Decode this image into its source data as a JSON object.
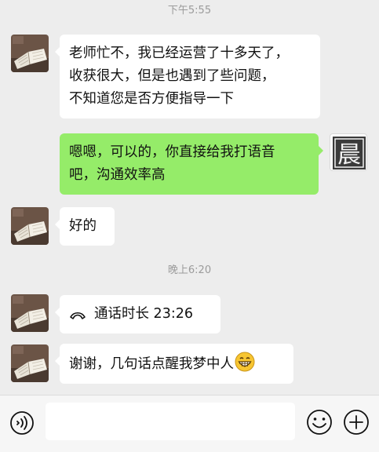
{
  "timestamps": [
    "下午5:55",
    "晚上6:20"
  ],
  "messages": [
    {
      "sender": "contact",
      "lines": [
        "老师忙不，我已经运营了十多天了，",
        "收获很大，但是也遇到了些问题，",
        "不知道您是否方便指导一下"
      ]
    },
    {
      "sender": "me",
      "lines": [
        "嗯嗯，可以的，你直接给我打语音",
        "吧，沟通效率高"
      ]
    },
    {
      "sender": "contact",
      "lines": [
        "好的"
      ]
    },
    {
      "sender": "contact",
      "type": "call",
      "label": "通话时长 23:26"
    },
    {
      "sender": "contact",
      "lines": [
        "谢谢，几句话点醒我梦中人"
      ],
      "emoji": "grinning-face"
    }
  ],
  "self_avatar_glyph": "晨",
  "colors": {
    "background": "#ededed",
    "incoming_bubble": "#ffffff",
    "outgoing_bubble": "#95ec69",
    "timestamp_text": "#9b9b9b"
  },
  "input_bar": {
    "voice_icon": "voice-icon",
    "emoji_icon": "emoji-icon",
    "add_icon": "add-icon",
    "text_value": ""
  }
}
